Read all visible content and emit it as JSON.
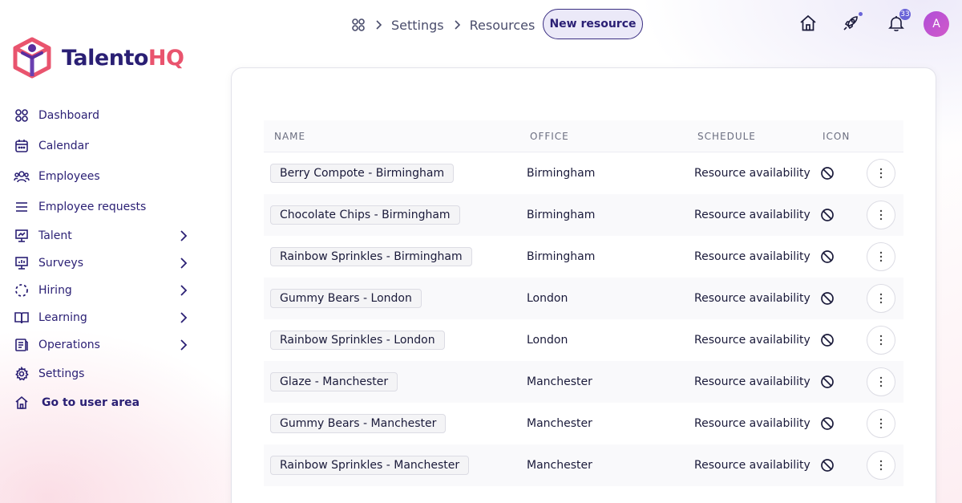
{
  "brand": {
    "name_part1": "Talento",
    "name_part2": "HQ",
    "logo_icon": "cube-person-logo"
  },
  "sidebar": {
    "items": [
      {
        "label": "Dashboard",
        "icon": "grid-icon",
        "has_chevron": false
      },
      {
        "label": "Calendar",
        "icon": "calendar-icon",
        "has_chevron": false
      },
      {
        "label": "Employees",
        "icon": "people-icon",
        "has_chevron": false
      },
      {
        "label": "Employee requests",
        "icon": "list-icon",
        "has_chevron": false
      },
      {
        "label": "Talent",
        "icon": "presentation-icon",
        "has_chevron": true
      },
      {
        "label": "Surveys",
        "icon": "chart-board-icon",
        "has_chevron": true
      },
      {
        "label": "Hiring",
        "icon": "dashed-circle-icon",
        "has_chevron": true
      },
      {
        "label": "Learning",
        "icon": "book-icon",
        "has_chevron": true
      },
      {
        "label": "Operations",
        "icon": "document-icon",
        "has_chevron": true
      },
      {
        "label": "Settings",
        "icon": "gear-icon",
        "has_chevron": false
      },
      {
        "label": "Go to user area",
        "icon": "home-icon",
        "has_chevron": false
      }
    ]
  },
  "header": {
    "breadcrumb": [
      "Settings",
      "Resources"
    ],
    "new_button_label": "New resource",
    "notification_count": "33",
    "avatar_initial": "A"
  },
  "table": {
    "columns": [
      "NAME",
      "OFFICE",
      "SCHEDULE",
      "ICON"
    ],
    "rows": [
      {
        "name": "Berry Compote - Birmingham",
        "office": "Birmingham",
        "schedule": "Resource availability"
      },
      {
        "name": "Chocolate Chips - Birmingham",
        "office": "Birmingham",
        "schedule": "Resource availability"
      },
      {
        "name": "Rainbow Sprinkles - Birmingham",
        "office": "Birmingham",
        "schedule": "Resource availability"
      },
      {
        "name": "Gummy Bears - London",
        "office": "London",
        "schedule": "Resource availability"
      },
      {
        "name": "Rainbow Sprinkles - London",
        "office": "London",
        "schedule": "Resource availability"
      },
      {
        "name": "Glaze - Manchester",
        "office": "Manchester",
        "schedule": "Resource availability"
      },
      {
        "name": "Gummy Bears - Manchester",
        "office": "Manchester",
        "schedule": "Resource availability"
      },
      {
        "name": "Rainbow Sprinkles - Manchester",
        "office": "Manchester",
        "schedule": "Resource availability"
      }
    ]
  }
}
